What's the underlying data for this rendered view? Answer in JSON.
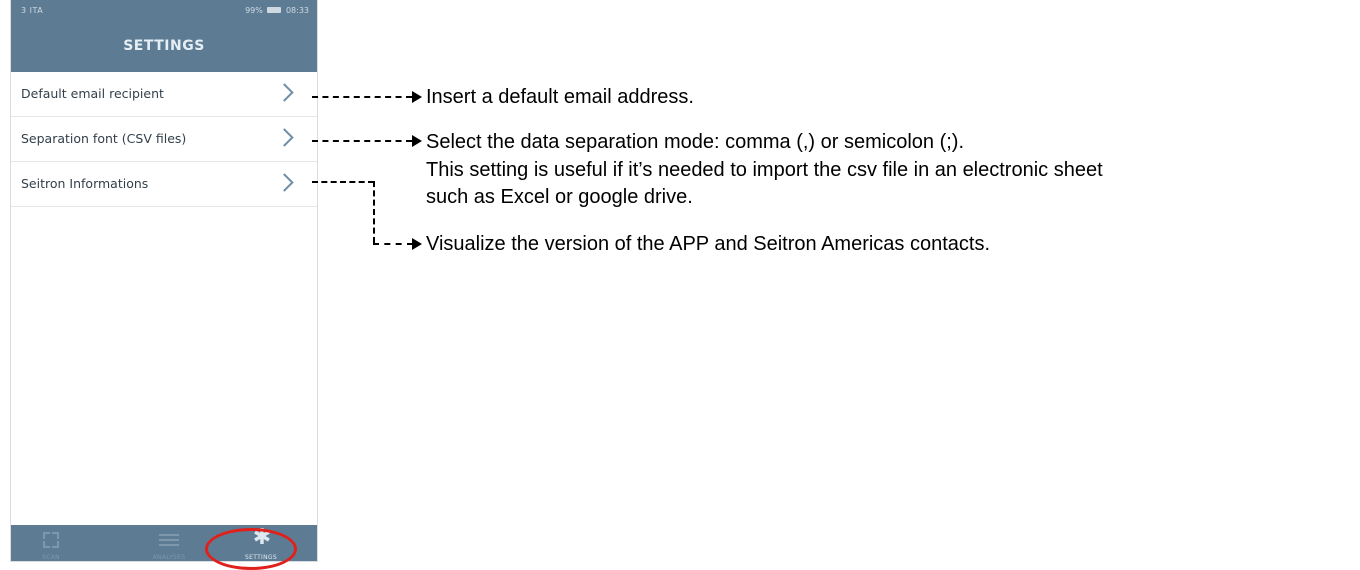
{
  "statusbar": {
    "carrier": "3 ITA",
    "right": "99%",
    "time": "08:33"
  },
  "header": {
    "title": "SETTINGS"
  },
  "menu": [
    {
      "label": "Default email recipient"
    },
    {
      "label": "Separation font (CSV files)"
    },
    {
      "label": "Seitron Informations"
    }
  ],
  "tabs": [
    {
      "label": "SCAN",
      "icon": "scan-icon"
    },
    {
      "label": "ANALYSES",
      "icon": "list-icon"
    },
    {
      "label": "SETTINGS",
      "icon": "gear-icon",
      "active": true
    }
  ],
  "annotations": {
    "email": "Insert a default email address.",
    "separation_line1": "Select the data separation mode: comma (,) or semicolon (;).",
    "separation_line2": "This setting is useful if it’s needed to import the csv file in an electronic sheet",
    "separation_line3": "such as Excel or google drive.",
    "info": "Visualize the version of the APP and Seitron Americas contacts."
  },
  "colors": {
    "header": "#5d7c94",
    "chevron": "#6f8fa8",
    "highlight": "#e0201b"
  }
}
